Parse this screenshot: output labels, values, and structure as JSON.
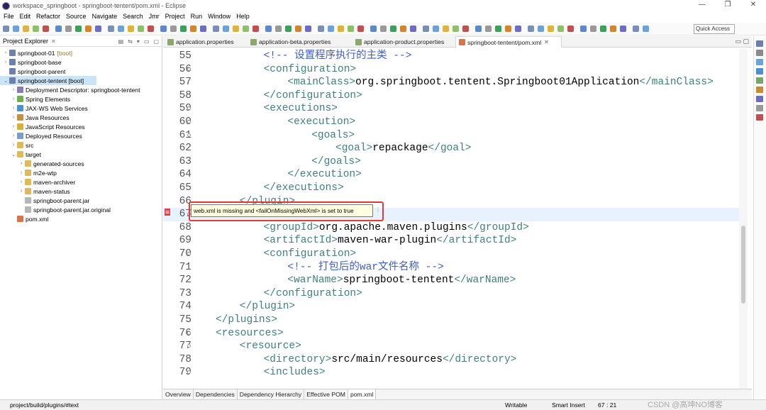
{
  "window": {
    "title": "workspace_springboot - springboot-tentent/pom.xml - Eclipse",
    "controls": [
      "—",
      "❐",
      "✕"
    ]
  },
  "menu": [
    "File",
    "Edit",
    "Refactor",
    "Source",
    "Navigate",
    "Search",
    "Jmr",
    "Project",
    "Run",
    "Window",
    "Help"
  ],
  "toolbar": {
    "quick_access": "Quick Access"
  },
  "explorer": {
    "title": "Project Explorer",
    "tree": [
      {
        "label": "springboot-01",
        "suffix": "[boot]",
        "indent": 0,
        "expanded": false,
        "icon": "project-icon"
      },
      {
        "label": "springboot-base",
        "suffix": "",
        "indent": 0,
        "expanded": false,
        "icon": "project-icon"
      },
      {
        "label": "springboot-parent",
        "suffix": "",
        "indent": 0,
        "expanded": null,
        "icon": "project-icon"
      },
      {
        "label": "springboot-tentent [boot]",
        "suffix": "",
        "indent": 0,
        "expanded": true,
        "icon": "project-icon",
        "selected": true
      },
      {
        "label": "Deployment Descriptor: springboot-tentent",
        "suffix": "",
        "indent": 1,
        "expanded": false,
        "icon": "descriptor-icon"
      },
      {
        "label": "Spring Elements",
        "suffix": "",
        "indent": 1,
        "expanded": false,
        "icon": "spring-icon"
      },
      {
        "label": "JAX-WS Web Services",
        "suffix": "",
        "indent": 1,
        "expanded": false,
        "icon": "webservice-icon"
      },
      {
        "label": "Java Resources",
        "suffix": "",
        "indent": 1,
        "expanded": false,
        "icon": "java-resources-icon"
      },
      {
        "label": "JavaScript Resources",
        "suffix": "",
        "indent": 1,
        "expanded": false,
        "icon": "js-resources-icon"
      },
      {
        "label": "Deployed Resources",
        "suffix": "",
        "indent": 1,
        "expanded": false,
        "icon": "deployed-icon"
      },
      {
        "label": "src",
        "suffix": "",
        "indent": 1,
        "expanded": false,
        "icon": "folder-icon"
      },
      {
        "label": "target",
        "suffix": "",
        "indent": 1,
        "expanded": true,
        "icon": "folder-icon"
      },
      {
        "label": "generated-sources",
        "suffix": "",
        "indent": 2,
        "expanded": false,
        "icon": "folder-icon"
      },
      {
        "label": "m2e-wtp",
        "suffix": "",
        "indent": 2,
        "expanded": false,
        "icon": "folder-icon"
      },
      {
        "label": "maven-archiver",
        "suffix": "",
        "indent": 2,
        "expanded": false,
        "icon": "folder-icon"
      },
      {
        "label": "maven-status",
        "suffix": "",
        "indent": 2,
        "expanded": false,
        "icon": "folder-icon"
      },
      {
        "label": "springboot-parent.jar",
        "suffix": "",
        "indent": 2,
        "expanded": null,
        "icon": "file-icon"
      },
      {
        "label": "springboot-parent.jar.original",
        "suffix": "",
        "indent": 2,
        "expanded": null,
        "icon": "file-icon"
      },
      {
        "label": "pom.xml",
        "suffix": "",
        "indent": 1,
        "expanded": null,
        "icon": "xml-file-icon"
      }
    ]
  },
  "editor": {
    "tabs": [
      {
        "label": "application.properties",
        "active": false
      },
      {
        "label": "application-beta.properties",
        "active": false
      },
      {
        "label": "application-product.properties",
        "active": false
      },
      {
        "label": "springboot-tentent/pom.xml",
        "active": true
      }
    ],
    "lines": [
      {
        "n": "55",
        "fold": false,
        "indent": 8,
        "parts": [
          [
            "cm",
            "<!-- 设置程序执行的主类 -->"
          ]
        ]
      },
      {
        "n": "56",
        "fold": true,
        "indent": 8,
        "parts": [
          [
            "tag",
            "<configuration>"
          ]
        ]
      },
      {
        "n": "57",
        "fold": false,
        "indent": 12,
        "parts": [
          [
            "tag",
            "<mainClass>"
          ],
          [
            "tx",
            "org.springboot.tentent.Springboot01Application"
          ],
          [
            "tag",
            "</mainClass>"
          ]
        ]
      },
      {
        "n": "58",
        "fold": false,
        "indent": 8,
        "parts": [
          [
            "tag",
            "</configuration>"
          ]
        ]
      },
      {
        "n": "59",
        "fold": true,
        "indent": 8,
        "parts": [
          [
            "tag",
            "<executions>"
          ]
        ]
      },
      {
        "n": "60",
        "fold": true,
        "indent": 12,
        "parts": [
          [
            "tag",
            "<execution>"
          ]
        ]
      },
      {
        "n": "61",
        "fold": true,
        "indent": 16,
        "parts": [
          [
            "tag",
            "<goals>"
          ]
        ]
      },
      {
        "n": "62",
        "fold": false,
        "indent": 20,
        "parts": [
          [
            "tag",
            "<goal>"
          ],
          [
            "tx",
            "repackage"
          ],
          [
            "tag",
            "</goal>"
          ]
        ]
      },
      {
        "n": "63",
        "fold": false,
        "indent": 16,
        "parts": [
          [
            "tag",
            "</goals>"
          ]
        ]
      },
      {
        "n": "64",
        "fold": false,
        "indent": 12,
        "parts": [
          [
            "tag",
            "</execution>"
          ]
        ]
      },
      {
        "n": "65",
        "fold": false,
        "indent": 8,
        "parts": [
          [
            "tag",
            "</executions>"
          ]
        ]
      },
      {
        "n": "66",
        "fold": false,
        "indent": 4,
        "parts": [
          [
            "tag",
            "</plugin>"
          ]
        ]
      },
      {
        "n": "67",
        "fold": true,
        "indent": 4,
        "parts": [],
        "current": true
      },
      {
        "n": "68",
        "fold": false,
        "indent": 8,
        "parts": [
          [
            "tag",
            "<groupId>"
          ],
          [
            "tx",
            "org.apache.maven.plugins"
          ],
          [
            "tag",
            "</groupId>"
          ]
        ]
      },
      {
        "n": "69",
        "fold": false,
        "indent": 8,
        "parts": [
          [
            "tag",
            "<artifactId>"
          ],
          [
            "tx",
            "maven-war-plugin"
          ],
          [
            "tag",
            "</artifactId>"
          ]
        ]
      },
      {
        "n": "70",
        "fold": true,
        "indent": 8,
        "parts": [
          [
            "tag",
            "<configuration>"
          ]
        ]
      },
      {
        "n": "71",
        "fold": false,
        "indent": 12,
        "parts": [
          [
            "cm",
            "<!-- 打包后的war文件名称 -->"
          ]
        ]
      },
      {
        "n": "72",
        "fold": false,
        "indent": 12,
        "parts": [
          [
            "tag",
            "<warName>"
          ],
          [
            "tx",
            "springboot-tentent"
          ],
          [
            "tag",
            "</warName>"
          ]
        ]
      },
      {
        "n": "73",
        "fold": false,
        "indent": 8,
        "parts": [
          [
            "tag",
            "</configuration>"
          ]
        ]
      },
      {
        "n": "74",
        "fold": false,
        "indent": 4,
        "parts": [
          [
            "tag",
            "</plugin>"
          ]
        ]
      },
      {
        "n": "75",
        "fold": false,
        "indent": 0,
        "parts": [
          [
            "tag",
            "</plugins>"
          ]
        ]
      },
      {
        "n": "76",
        "fold": true,
        "indent": 0,
        "parts": [
          [
            "tag",
            "<resources>"
          ]
        ]
      },
      {
        "n": "77",
        "fold": true,
        "indent": 4,
        "parts": [
          [
            "tag",
            "<resource>"
          ]
        ]
      },
      {
        "n": "78",
        "fold": false,
        "indent": 8,
        "parts": [
          [
            "tag",
            "<directory>"
          ],
          [
            "tx",
            "src/main/resources"
          ],
          [
            "tag",
            "</directory>"
          ]
        ]
      },
      {
        "n": "79",
        "fold": true,
        "indent": 8,
        "parts": [
          [
            "tag",
            "<includes>"
          ]
        ]
      }
    ],
    "tooltip": "web.xml is missing and <failOnMissingWebXml> is set to true"
  },
  "pom_tabs": [
    "Overview",
    "Dependencies",
    "Dependency Hierarchy",
    "Effective POM",
    "pom.xml"
  ],
  "pom_active": "pom.xml",
  "status": {
    "path": "project/build/plugins/#text",
    "writable": "Writable",
    "insert_mode": "Smart Insert",
    "position": "67 : 21",
    "watermark": "CSDN @高坤NO博客"
  },
  "colors": {
    "tag": "#3f7f7f",
    "comment": "#3f5fbf",
    "selection": "#cce4f7",
    "tooltip_bg": "#ffffe1",
    "highlight_box": "#e53935"
  }
}
